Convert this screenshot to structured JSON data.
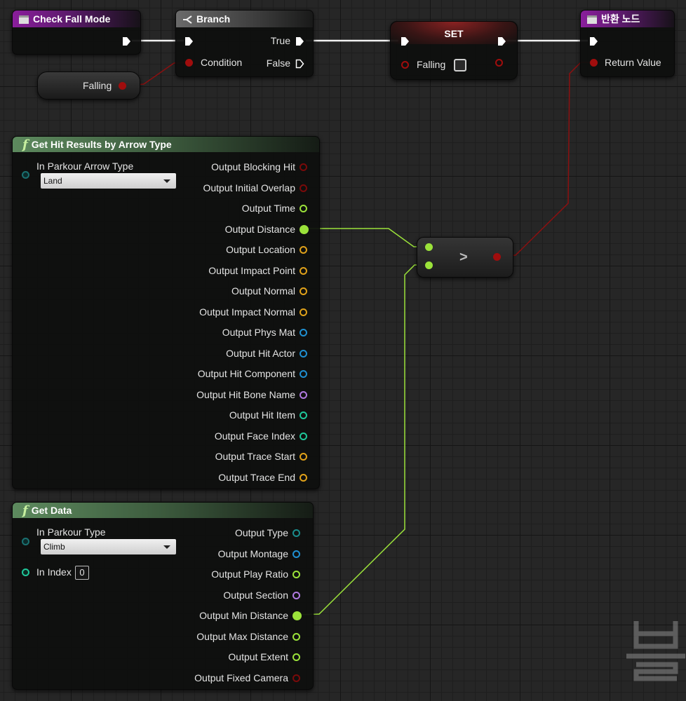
{
  "nodes": {
    "check_fall_mode": {
      "title": "Check Fall Mode"
    },
    "branch": {
      "title": "Branch",
      "true_label": "True",
      "false_label": "False",
      "condition_label": "Condition"
    },
    "falling_var": {
      "label": "Falling"
    },
    "set_node": {
      "title": "SET",
      "falling_label": "Falling"
    },
    "return_node": {
      "title": "반환 노드",
      "return_label": "Return Value"
    },
    "compare": {
      "symbol": ">"
    },
    "get_hit": {
      "title": "Get Hit Results by Arrow Type",
      "input_label": "In Parkour Arrow Type",
      "dropdown_value": "Land",
      "outputs": [
        {
          "label": "Output Blocking Hit",
          "color": "#7a0a0a"
        },
        {
          "label": "Output Initial Overlap",
          "color": "#7a0a0a"
        },
        {
          "label": "Output Time",
          "color": "#9be23a"
        },
        {
          "label": "Output Distance",
          "color": "#9be23a"
        },
        {
          "label": "Output Location",
          "color": "#e0a11a"
        },
        {
          "label": "Output Impact Point",
          "color": "#e0a11a"
        },
        {
          "label": "Output Normal",
          "color": "#e0a11a"
        },
        {
          "label": "Output Impact Normal",
          "color": "#e0a11a"
        },
        {
          "label": "Output Phys Mat",
          "color": "#1f8fd1"
        },
        {
          "label": "Output Hit Actor",
          "color": "#1f8fd1"
        },
        {
          "label": "Output Hit Component",
          "color": "#1f8fd1"
        },
        {
          "label": "Output Hit Bone Name",
          "color": "#b07ae0"
        },
        {
          "label": "Output Hit Item",
          "color": "#1fc79a"
        },
        {
          "label": "Output Face Index",
          "color": "#1fc79a"
        },
        {
          "label": "Output Trace Start",
          "color": "#e0a11a"
        },
        {
          "label": "Output Trace End",
          "color": "#e0a11a"
        }
      ]
    },
    "get_data": {
      "title": "Get Data",
      "input_label": "In Parkour Type",
      "dropdown_value": "Climb",
      "index_label": "In Index",
      "index_value": "0",
      "outputs": [
        {
          "label": "Output Type",
          "color": "#1a8c8c"
        },
        {
          "label": "Output Montage",
          "color": "#1f8fd1"
        },
        {
          "label": "Output Play Ratio",
          "color": "#9be23a"
        },
        {
          "label": "Output Section",
          "color": "#b07ae0"
        },
        {
          "label": "Output Min Distance",
          "color": "#9be23a"
        },
        {
          "label": "Output Max Distance",
          "color": "#9be23a"
        },
        {
          "label": "Output Extent",
          "color": "#9be23a"
        },
        {
          "label": "Output Fixed Camera",
          "color": "#7a0a0a"
        }
      ]
    }
  },
  "colors": {
    "exec": "#ffffff",
    "bool": "#a00d0d",
    "float": "#9be23a",
    "enum_pin": "#1a7070",
    "int_pin": "#1fc79a"
  },
  "icons": [
    "event-icon",
    "branch-icon",
    "function-icon",
    "watermark-logo"
  ]
}
